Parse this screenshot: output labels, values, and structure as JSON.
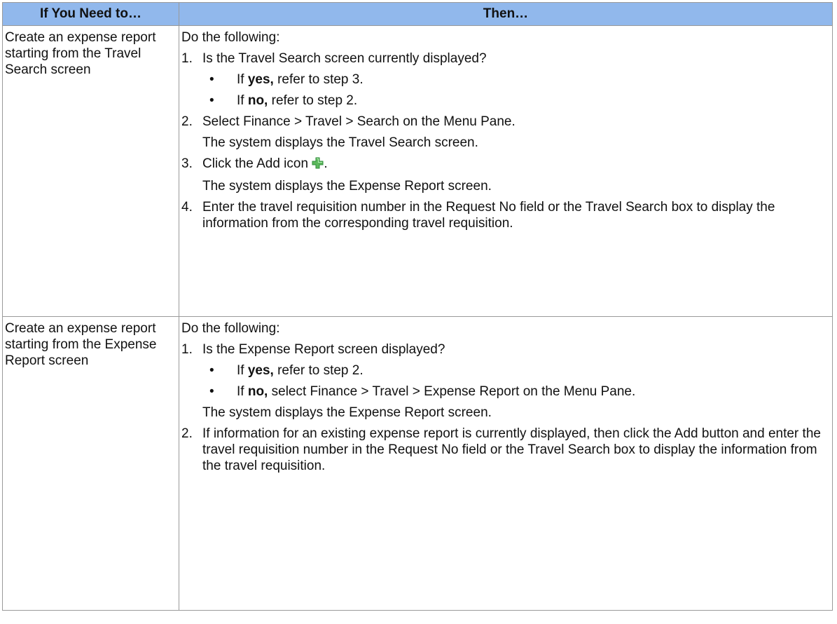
{
  "table": {
    "headers": [
      "If You Need to…",
      "Then…"
    ],
    "rows": [
      {
        "need": "Create an expense report starting from the Travel Search screen",
        "intro": "Do the following:",
        "step1_num": "1.",
        "step1_text": "Is the Travel Search screen currently displayed?",
        "bullet_char": "•",
        "b1_pre": "If ",
        "b1_bold": "yes,",
        "b1_post": " refer to step 3.",
        "b2_pre": "If ",
        "b2_bold": "no,",
        "b2_post": " refer to step 2.",
        "step2_num": "2.",
        "step2_text": "Select Finance > Travel > Search on the Menu Pane.",
        "step2_note": "The system displays the Travel Search screen.",
        "step3_num": "3.",
        "step3_pre": "Click the Add icon ",
        "step3_post": ".",
        "step3_note": "The system displays the Expense Report screen.",
        "step4_num": "4.",
        "step4_text": "Enter the travel requisition number in the Request No field or the Travel Search box to display the information from the corresponding travel requisition."
      },
      {
        "need": "Create an expense report starting from the Expense Report screen",
        "intro": "Do the following:",
        "step1_num": "1.",
        "step1_text": "Is the Expense Report screen displayed?",
        "bullet_char": "•",
        "b1_pre": "If ",
        "b1_bold": "yes,",
        "b1_post": " refer to step 2.",
        "b2_pre": "If ",
        "b2_bold": "no,",
        "b2_post": " select Finance > Travel > Expense Report on the Menu Pane.",
        "step1_note": "The system displays the Expense Report screen.",
        "step2_num": "2.",
        "step2_text": "If information for an existing expense report is currently displayed, then click the Add button and enter the travel requisition number in the Request No field or the Travel Search box to display the information from the travel requisition."
      }
    ]
  },
  "colors": {
    "header_bg": "#91b8ec",
    "border": "#9a9a9a",
    "add_icon": "#5cb85c"
  },
  "icons": {
    "add_icon": "plus-icon"
  }
}
